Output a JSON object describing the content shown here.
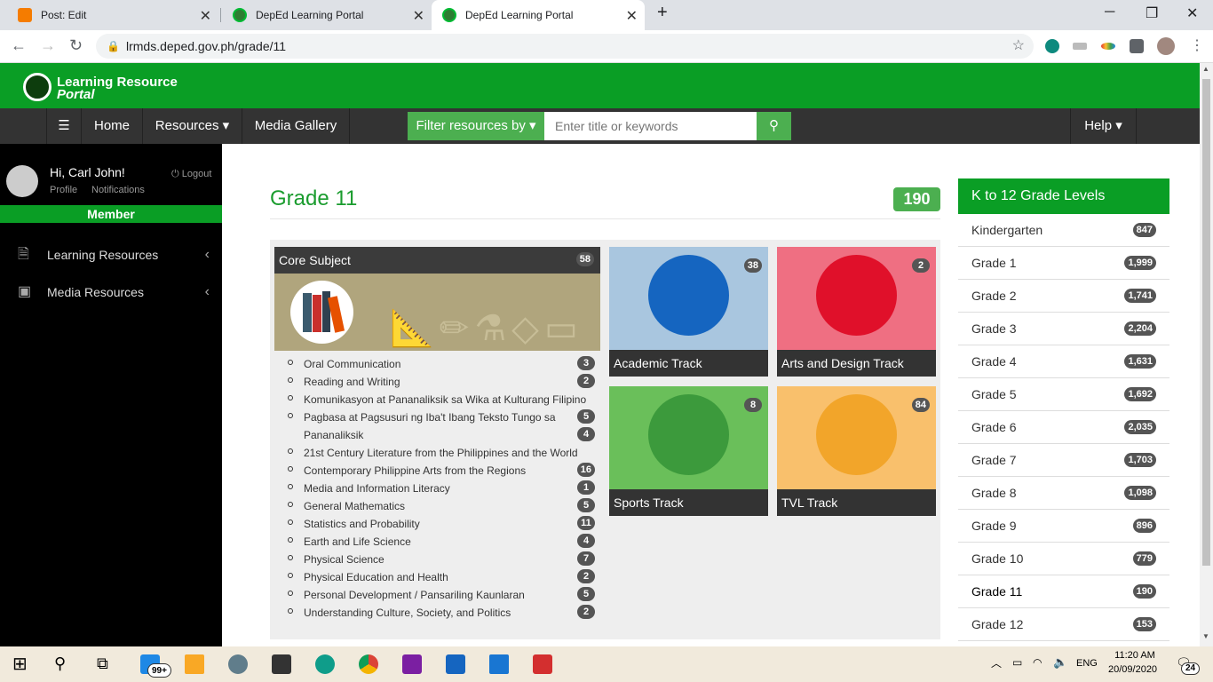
{
  "browser": {
    "tabs": [
      {
        "title": "Post: Edit"
      },
      {
        "title": "DepEd Learning Portal"
      },
      {
        "title": "DepEd Learning Portal"
      }
    ],
    "new_tab": "+",
    "url": "lrmds.deped.gov.ph/grade/11"
  },
  "site": {
    "logo_line1": "Learning Resource",
    "logo_line2": "Portal",
    "brand_color": "#0a9e25"
  },
  "nav": {
    "home": "Home",
    "resources": "Resources ▾",
    "media_gallery": "Media Gallery",
    "filter": "Filter resources by ▾",
    "search_placeholder": "Enter title or keywords",
    "help": "Help ▾"
  },
  "sidebar": {
    "greeting": "Hi, Carl John!",
    "logout": "Logout",
    "profile": "Profile",
    "notifications": "Notifications",
    "member": "Member",
    "items": [
      {
        "label": "Learning Resources",
        "icon": "document-icon"
      },
      {
        "label": "Media Resources",
        "icon": "image-icon"
      }
    ]
  },
  "main": {
    "title": "Grade 11",
    "count": "190",
    "core": {
      "title": "Core Subject",
      "count": "58",
      "subjects": [
        {
          "name": "Oral Communication",
          "count": "3"
        },
        {
          "name": "Reading and Writing",
          "count": "2"
        },
        {
          "name": "Komunikasyon at Pananaliksik sa Wika at Kulturang Filipino",
          "count": ""
        },
        {
          "name": "Pagbasa at Pagsusuri ng Iba't Ibang Teksto Tungo sa",
          "count": "5"
        },
        {
          "name": "Pananaliksik",
          "count": "4"
        },
        {
          "name": "21st Century Literature from the Philippines and the World",
          "count": ""
        },
        {
          "name": "Contemporary Philippine Arts from the Regions",
          "count": "16"
        },
        {
          "name": "Media and Information Literacy",
          "count": "1"
        },
        {
          "name": "General Mathematics",
          "count": "5"
        },
        {
          "name": "Statistics and Probability",
          "count": "11"
        },
        {
          "name": "Earth and Life Science",
          "count": "4"
        },
        {
          "name": "Physical Science",
          "count": "7"
        },
        {
          "name": "Physical Education and Health",
          "count": "2"
        },
        {
          "name": "Personal Development / Pansariling Kaunlaran",
          "count": "5"
        },
        {
          "name": "Understanding Culture, Society, and Politics",
          "count": "2"
        }
      ]
    },
    "tracks": [
      {
        "name": "Academic Track",
        "count": "38",
        "bg": "#a9c6df",
        "circle": "#1565c0",
        "icon": "book-icon"
      },
      {
        "name": "Arts and Design Track",
        "count": "2",
        "bg": "#ef6f82",
        "circle": "#e0102a",
        "icon": "masks-icon"
      },
      {
        "name": "Sports Track",
        "count": "8",
        "bg": "#6abf5a",
        "circle": "#3c9a3c",
        "icon": "runner-icon"
      },
      {
        "name": "TVL Track",
        "count": "84",
        "bg": "#f9c06c",
        "circle": "#f2a52a",
        "icon": "tools-icon"
      }
    ]
  },
  "grade_levels": {
    "title": "K to 12 Grade Levels",
    "items": [
      {
        "label": "Kindergarten",
        "count": "847"
      },
      {
        "label": "Grade 1",
        "count": "1,999"
      },
      {
        "label": "Grade 2",
        "count": "1,741"
      },
      {
        "label": "Grade 3",
        "count": "2,204"
      },
      {
        "label": "Grade 4",
        "count": "1,631"
      },
      {
        "label": "Grade 5",
        "count": "1,692"
      },
      {
        "label": "Grade 6",
        "count": "2,035"
      },
      {
        "label": "Grade 7",
        "count": "1,703"
      },
      {
        "label": "Grade 8",
        "count": "1,098"
      },
      {
        "label": "Grade 9",
        "count": "896"
      },
      {
        "label": "Grade 10",
        "count": "779"
      },
      {
        "label": "Grade 11",
        "count": "190"
      },
      {
        "label": "Grade 12",
        "count": "153"
      }
    ]
  },
  "taskbar": {
    "mail_badge": "99+",
    "lang": "ENG",
    "time": "11:20 AM",
    "date": "20/09/2020",
    "notif_count": "24"
  }
}
